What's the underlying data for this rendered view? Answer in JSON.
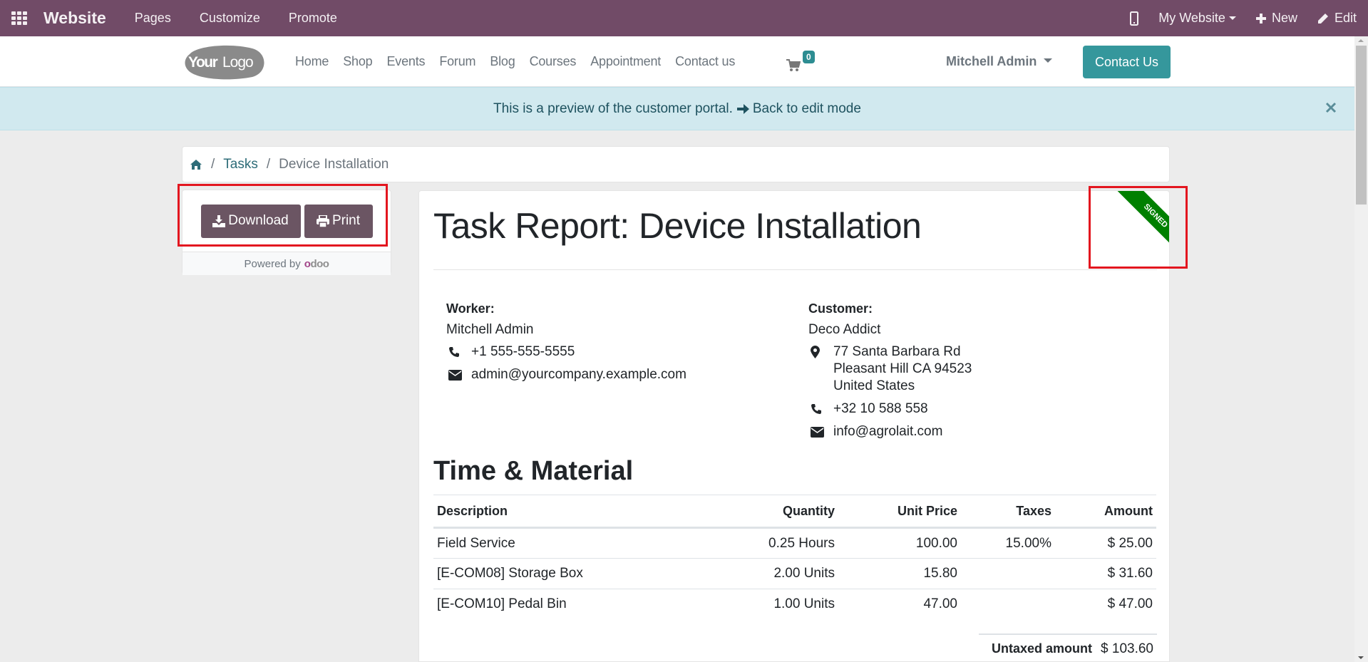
{
  "topbar": {
    "brand": "Website",
    "menus": [
      "Pages",
      "Customize",
      "Promote"
    ],
    "right": {
      "website_switcher": "My Website",
      "new_label": "New",
      "edit_label": "Edit"
    },
    "color": "#714b67"
  },
  "header": {
    "logo_text_bold": "Your",
    "logo_text_light": "Logo",
    "nav": [
      "Home",
      "Shop",
      "Events",
      "Forum",
      "Blog",
      "Courses",
      "Appointment",
      "Contact us"
    ],
    "cart_count": "0",
    "user": "Mitchell Admin",
    "contact_button": "Contact Us",
    "accent": "#35979c"
  },
  "banner": {
    "text": "This is a preview of the customer portal.",
    "link": "Back to edit mode"
  },
  "breadcrumb": {
    "items": [
      "Tasks"
    ],
    "current": "Device Installation"
  },
  "sidebar": {
    "download_label": "Download",
    "print_label": "Print",
    "powered_by": "Powered by",
    "powered_brand": "odoo"
  },
  "report": {
    "title": "Task Report: Device Installation",
    "ribbon": "SIGNED",
    "ribbon_color": "#008000",
    "worker": {
      "label": "Worker:",
      "name": "Mitchell Admin",
      "phone": "+1 555-555-5555",
      "email": "admin@yourcompany.example.com"
    },
    "customer": {
      "label": "Customer:",
      "name": "Deco Addict",
      "address": [
        "77 Santa Barbara Rd",
        "Pleasant Hill CA 94523",
        "United States"
      ],
      "phone": "+32 10 588 558",
      "email": "info@agrolait.com"
    },
    "section_title": "Time & Material",
    "table": {
      "headers": [
        "Description",
        "Quantity",
        "Unit Price",
        "Taxes",
        "Amount"
      ],
      "rows": [
        [
          "Field Service",
          "0.25 Hours",
          "100.00",
          "15.00%",
          "$ 25.00"
        ],
        [
          "[E-COM08] Storage Box",
          "2.00 Units",
          "15.80",
          "",
          "$ 31.60"
        ],
        [
          "[E-COM10] Pedal Bin",
          "1.00 Units",
          "47.00",
          "",
          "$ 47.00"
        ]
      ]
    },
    "totals": {
      "untaxed_label": "Untaxed amount",
      "untaxed_value": "$ 103.60"
    }
  }
}
